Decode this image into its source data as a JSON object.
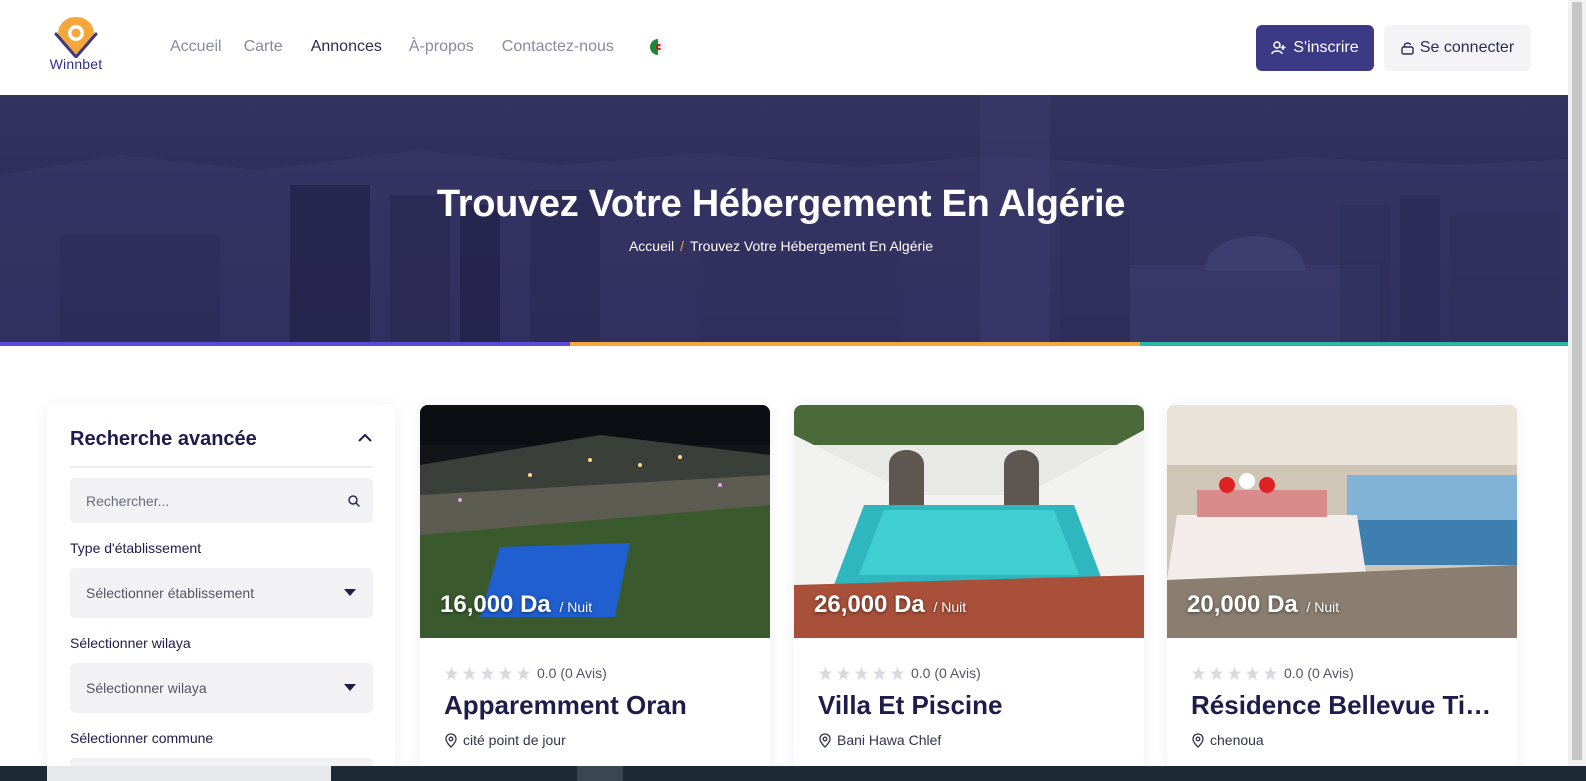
{
  "brand": {
    "logo_text": "Winnbet"
  },
  "nav": {
    "items": [
      "Accueil",
      "Carte",
      "Annonces",
      "À-propos",
      "Contactez-nous"
    ],
    "active": "Annonces",
    "language_flag": "dz-flag-icon"
  },
  "auth": {
    "signup_label": "S'inscrire",
    "login_label": "Se connecter"
  },
  "hero": {
    "title": "Trouvez Votre Hébergement En Algérie",
    "breadcrumb": {
      "home": "Accueil",
      "separator": "/",
      "current": "Trouvez Votre Hébergement En Algérie"
    }
  },
  "sidebar": {
    "title": "Recherche avancée",
    "search_placeholder": "Rechercher...",
    "filters": [
      {
        "label": "Type d'établissement",
        "value": "Sélectionner établissement"
      },
      {
        "label": "Sélectionner wilaya",
        "value": "Sélectionner wilaya"
      },
      {
        "label": "Sélectionner commune",
        "value": ""
      }
    ]
  },
  "listings": [
    {
      "price": "16,000 Da",
      "unit": "/ Nuit",
      "rating": "0.0 (0 Avis)",
      "title": "Apparemment Oran",
      "location": "cité point de jour"
    },
    {
      "price": "26,000 Da",
      "unit": "/ Nuit",
      "rating": "0.0 (0 Avis)",
      "title": "Villa Et Piscine",
      "location": "Bani Hawa Chlef"
    },
    {
      "price": "20,000 Da",
      "unit": "/ Nuit",
      "rating": "0.0 (0 Avis)",
      "title": "Résidence Bellevue Tipaza",
      "location": "chenoua"
    }
  ],
  "colors": {
    "primary": "#3d3a85",
    "hero_overlay": "#2c2b58",
    "accent_orange": "#f6a73b",
    "stripe_purple": "#5b4bd6",
    "stripe_teal": "#2bb8a3",
    "star_empty": "#d9d9df"
  }
}
